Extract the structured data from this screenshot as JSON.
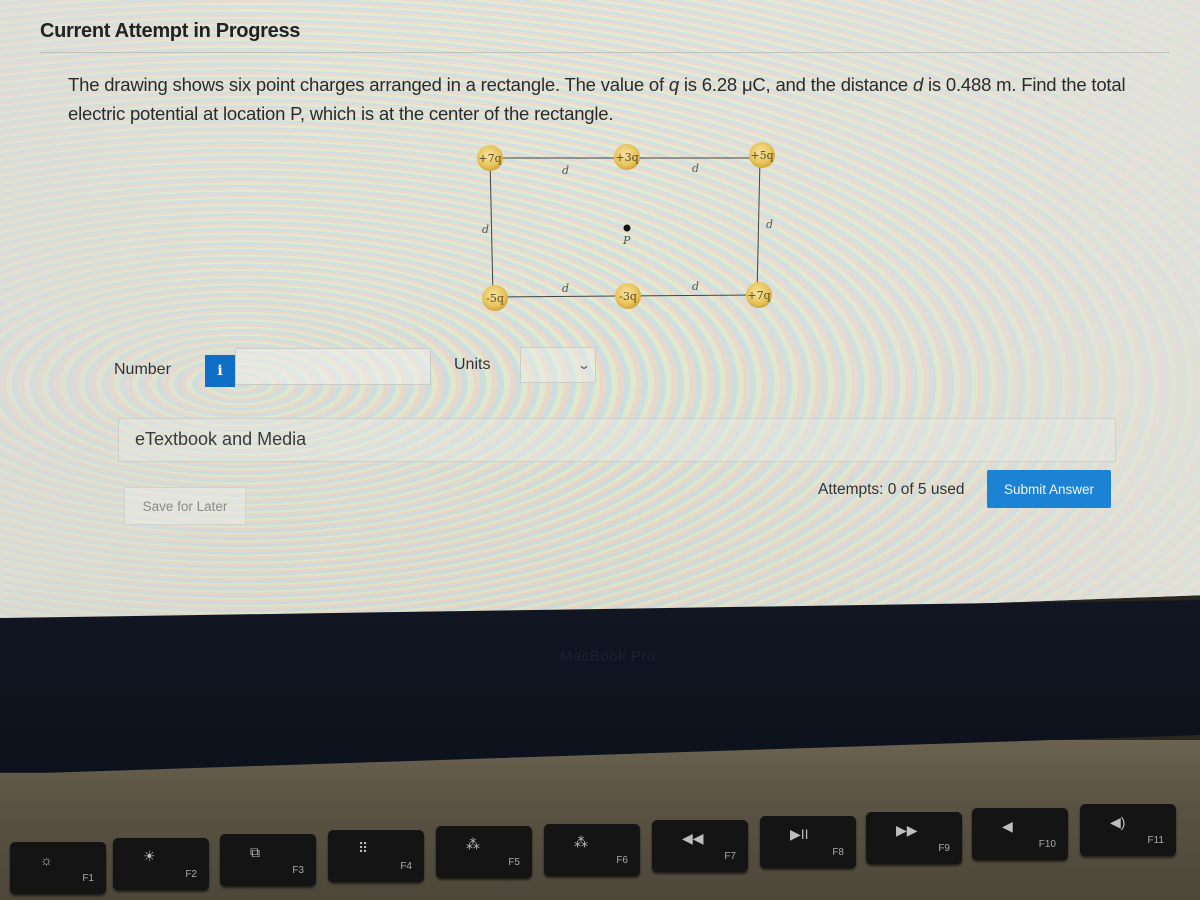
{
  "header": {
    "title": "Current Attempt in Progress"
  },
  "question": {
    "text_part1": "The drawing shows six point charges arranged in a rectangle. The value of ",
    "q_symbol": "q",
    "text_part2": " is 6.28 μC, and the distance ",
    "d_symbol": "d",
    "text_part3": " is 0.488 m. Find the total electric potential at location P, which is at the center of the rectangle."
  },
  "diagram": {
    "charges": {
      "top_left": "+7q",
      "top_middle": "+3q",
      "top_right": "+5q",
      "bottom_left": "-5q",
      "bottom_middle": "-3q",
      "bottom_right": "+7q"
    },
    "distance_label": "d",
    "point_label": "P"
  },
  "answer": {
    "number_label": "Number",
    "info_icon": "i",
    "number_value": "",
    "units_label": "Units",
    "units_value": "",
    "units_chevron": "⌄"
  },
  "resources": {
    "etextbook_label": "eTextbook and Media"
  },
  "actions": {
    "save_later_label": "Save for Later",
    "attempts_text": "Attempts: 0 of 5 used",
    "submit_label": "Submit Answer"
  },
  "colors": {
    "primary_blue": "#1b82d4",
    "info_blue": "#0f6fc6",
    "charge_fill": "#e8c45a"
  },
  "device": {
    "brand": "MacBook Pro",
    "function_keys": [
      {
        "fn": "F1",
        "icon": "brightness-down-icon",
        "glyph": "☼"
      },
      {
        "fn": "F2",
        "icon": "brightness-up-icon",
        "glyph": "☀"
      },
      {
        "fn": "F3",
        "icon": "mission-control-icon",
        "glyph": "⧉"
      },
      {
        "fn": "F4",
        "icon": "launchpad-icon",
        "glyph": "⠿"
      },
      {
        "fn": "F5",
        "icon": "keyboard-light-down-icon",
        "glyph": "⁂"
      },
      {
        "fn": "F6",
        "icon": "keyboard-light-up-icon",
        "glyph": "⁂"
      },
      {
        "fn": "F7",
        "icon": "rewind-icon",
        "glyph": "◀◀"
      },
      {
        "fn": "F8",
        "icon": "play-pause-icon",
        "glyph": "▶II"
      },
      {
        "fn": "F9",
        "icon": "fast-forward-icon",
        "glyph": "▶▶"
      },
      {
        "fn": "F10",
        "icon": "mute-icon",
        "glyph": "◀"
      },
      {
        "fn": "F11",
        "icon": "volume-down-icon",
        "glyph": "◀)"
      }
    ]
  }
}
